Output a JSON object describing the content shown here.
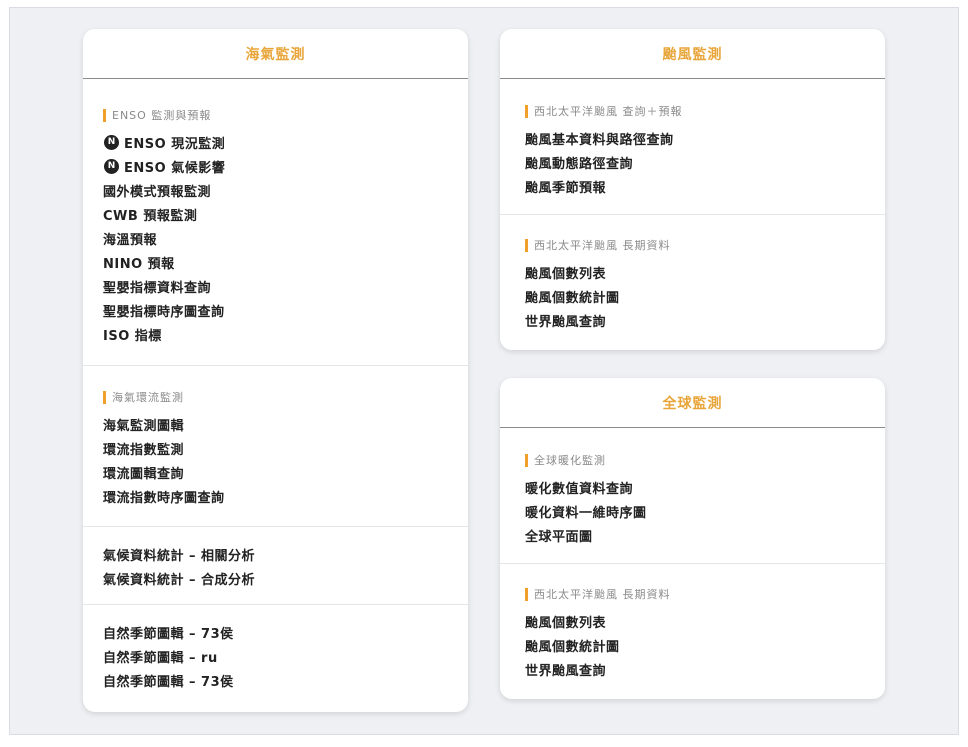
{
  "ocean": {
    "title": "海氣監測",
    "s1": {
      "title": "ENSO 監測與預報",
      "items": [
        {
          "icon": "N",
          "label": "ENSO 現況監測"
        },
        {
          "icon": "N",
          "label": "ENSO 氣候影響"
        },
        {
          "label": "國外模式預報監測"
        },
        {
          "label": "CWB 預報監測"
        },
        {
          "label": "海溫預報"
        },
        {
          "label": "NINO 預報"
        },
        {
          "label": "聖嬰指標資料查詢"
        },
        {
          "label": "聖嬰指標時序圖查詢"
        },
        {
          "label": "ISO 指標"
        }
      ]
    },
    "s2": {
      "title": "海氣環流監測",
      "items": [
        "海氣監測圖輯",
        "環流指數監測",
        "環流圖輯查詢",
        "環流指數時序圖查詢"
      ]
    },
    "s3": {
      "items": [
        "氣候資料統計 – 相關分析",
        "氣候資料統計 – 合成分析"
      ]
    },
    "s4": {
      "items": [
        "自然季節圖輯 – 73侯",
        "自然季節圖輯 – ru",
        "自然季節圖輯 – 73侯"
      ]
    }
  },
  "typhoon": {
    "title": "颱風監測",
    "s1": {
      "title": "西北太平洋颱風 查詢＋預報",
      "items": [
        "颱風基本資料與路徑查詢",
        "颱風動態路徑查詢",
        "颱風季節預報"
      ]
    },
    "s2": {
      "title": "西北太平洋颱風 長期資料",
      "items": [
        "颱風個數列表",
        "颱風個數統計圖",
        "世界颱風查詢"
      ]
    }
  },
  "global": {
    "title": "全球監測",
    "s1": {
      "title": "全球暖化監測",
      "items": [
        "暖化數值資料查詢",
        "暖化資料一維時序圖",
        "全球平面圖"
      ]
    },
    "s2": {
      "title": "西北太平洋颱風 長期資料",
      "items": [
        "颱風個數列表",
        "颱風個數統計圖",
        "世界颱風查詢"
      ]
    }
  }
}
